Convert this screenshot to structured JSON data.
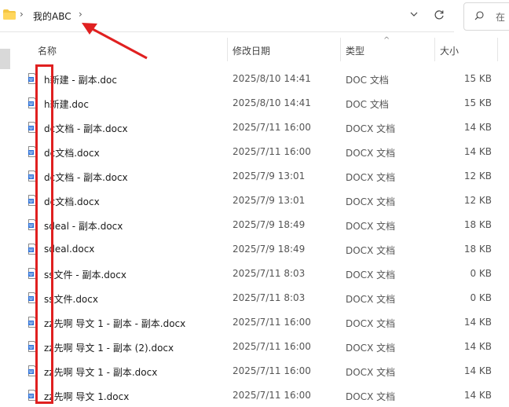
{
  "address_bar": {
    "path": [
      "我的ABC"
    ],
    "separator_glyph": "›"
  },
  "search": {
    "placeholder": "在"
  },
  "columns": {
    "name": "名称",
    "modified": "修改日期",
    "type": "类型",
    "size": "大小"
  },
  "files": [
    {
      "name": "h新建 - 副本.doc",
      "modified": "2025/8/10 14:41",
      "type": "DOC 文档",
      "size": "15 KB"
    },
    {
      "name": "h新建.doc",
      "modified": "2025/8/10 14:41",
      "type": "DOC 文档",
      "size": "15 KB"
    },
    {
      "name": "dc文档 - 副本.docx",
      "modified": "2025/7/11 16:00",
      "type": "DOCX 文档",
      "size": "14 KB"
    },
    {
      "name": "dc文档.docx",
      "modified": "2025/7/11 16:00",
      "type": "DOCX 文档",
      "size": "14 KB"
    },
    {
      "name": "dc文档 - 副本.docx",
      "modified": "2025/7/9 13:01",
      "type": "DOCX 文档",
      "size": "12 KB"
    },
    {
      "name": "dc文档.docx",
      "modified": "2025/7/9 13:01",
      "type": "DOCX 文档",
      "size": "12 KB"
    },
    {
      "name": "sdeal - 副本.docx",
      "modified": "2025/7/9 18:49",
      "type": "DOCX 文档",
      "size": "18 KB"
    },
    {
      "name": "sdeal.docx",
      "modified": "2025/7/9 18:49",
      "type": "DOCX 文档",
      "size": "18 KB"
    },
    {
      "name": "ss文件 - 副本.docx",
      "modified": "2025/7/11 8:03",
      "type": "DOCX 文档",
      "size": "0 KB"
    },
    {
      "name": "ss文件.docx",
      "modified": "2025/7/11 8:03",
      "type": "DOCX 文档",
      "size": "0 KB"
    },
    {
      "name": "zz先啊 导文 1 - 副本 - 副本.docx",
      "modified": "2025/7/11 16:00",
      "type": "DOCX 文档",
      "size": "14 KB"
    },
    {
      "name": "zz先啊 导文 1 - 副本 (2).docx",
      "modified": "2025/7/11 16:00",
      "type": "DOCX 文档",
      "size": "14 KB"
    },
    {
      "name": "zz先啊 导文 1 - 副本.docx",
      "modified": "2025/7/11 16:00",
      "type": "DOCX 文档",
      "size": "14 KB"
    },
    {
      "name": "zz先啊 导文 1.docx",
      "modified": "2025/7/11 16:00",
      "type": "DOCX 文档",
      "size": "14 KB"
    }
  ],
  "icons": {
    "folder": "folder-icon",
    "document": "word-document-icon",
    "refresh": "refresh-icon",
    "search": "search-icon",
    "dropdown": "chevron-down-icon"
  },
  "colors": {
    "annotation": "#e02020",
    "folder": "#f4c542",
    "word_icon": "#2b6fd6"
  }
}
